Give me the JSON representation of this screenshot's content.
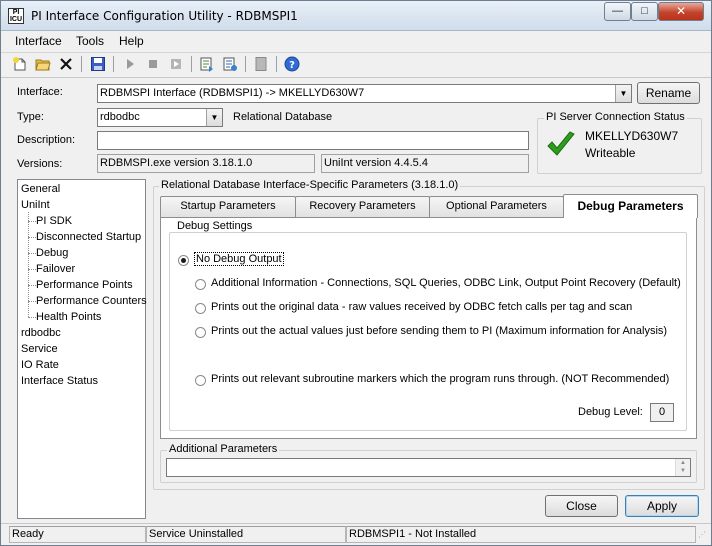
{
  "window": {
    "title": "PI Interface Configuration Utility - RDBMSPI1",
    "app_icon_text": "PI\nICU",
    "min_glyph": "—",
    "max_glyph": "□",
    "close_glyph": "✕"
  },
  "menu": [
    "Interface",
    "Tools",
    "Help"
  ],
  "toolbar_icons": [
    "new-icon",
    "open-icon",
    "delete-icon",
    "save-icon",
    "start-icon",
    "stop-icon",
    "restart-icon",
    "export-icon",
    "import-icon",
    "copy-icon",
    "help-icon"
  ],
  "form": {
    "interface_label": "Interface:",
    "interface_value": "RDBMSPI Interface (RDBMSPI1) -> MKELLYD630W7",
    "rename_label": "Rename",
    "type_label": "Type:",
    "type_value": "rdbodbc",
    "type_description": "Relational Database",
    "description_label": "Description:",
    "description_value": "",
    "versions_label": "Versions:",
    "exe_version": "RDBMSPI.exe version 3.18.1.0",
    "uniint_version": "UniInt version 4.4.5.4"
  },
  "server_status": {
    "title": "PI Server Connection Status",
    "server": "MKELLYD630W7",
    "state": "Writeable",
    "check_color": "#2e9d1e"
  },
  "tree": {
    "items": [
      {
        "label": "General"
      },
      {
        "label": "UniInt"
      },
      {
        "label": "PI SDK"
      },
      {
        "label": "Disconnected Startup"
      },
      {
        "label": "Debug"
      },
      {
        "label": "Failover"
      },
      {
        "label": "Performance Points"
      },
      {
        "label": "Performance Counters"
      },
      {
        "label": "Health Points"
      },
      {
        "label": "rdbodbc"
      },
      {
        "label": "Service"
      },
      {
        "label": "IO Rate"
      },
      {
        "label": "Interface Status"
      }
    ]
  },
  "params": {
    "group_title": "Relational Database Interface-Specific Parameters (3.18.1.0)",
    "tabs": [
      {
        "label": "Startup Parameters"
      },
      {
        "label": "Recovery Parameters"
      },
      {
        "label": "Optional Parameters"
      },
      {
        "label": "Debug Parameters"
      }
    ],
    "debug_settings_title": "Debug Settings",
    "options": [
      {
        "label": "No Debug Output",
        "checked": true
      },
      {
        "label": "Additional Information - Connections, SQL Queries, ODBC Link, Output Point Recovery (Default)",
        "checked": false
      },
      {
        "label": "Prints out the original data - raw values received by ODBC fetch calls per tag and scan",
        "checked": false
      },
      {
        "label": "Prints out the actual values just before sending them to PI (Maximum information for Analysis)",
        "checked": false
      },
      {
        "label": "Prints out relevant subroutine markers which the program runs through. (NOT Recommended)",
        "checked": false
      }
    ],
    "debug_level_label": "Debug Level:",
    "debug_level_value": "0",
    "additional_title": "Additional Parameters",
    "additional_value": ""
  },
  "buttons": {
    "close": "Close",
    "apply": "Apply"
  },
  "status": {
    "state": "Ready",
    "service": "Service Uninstalled",
    "install": "RDBMSPI1 - Not Installed"
  }
}
